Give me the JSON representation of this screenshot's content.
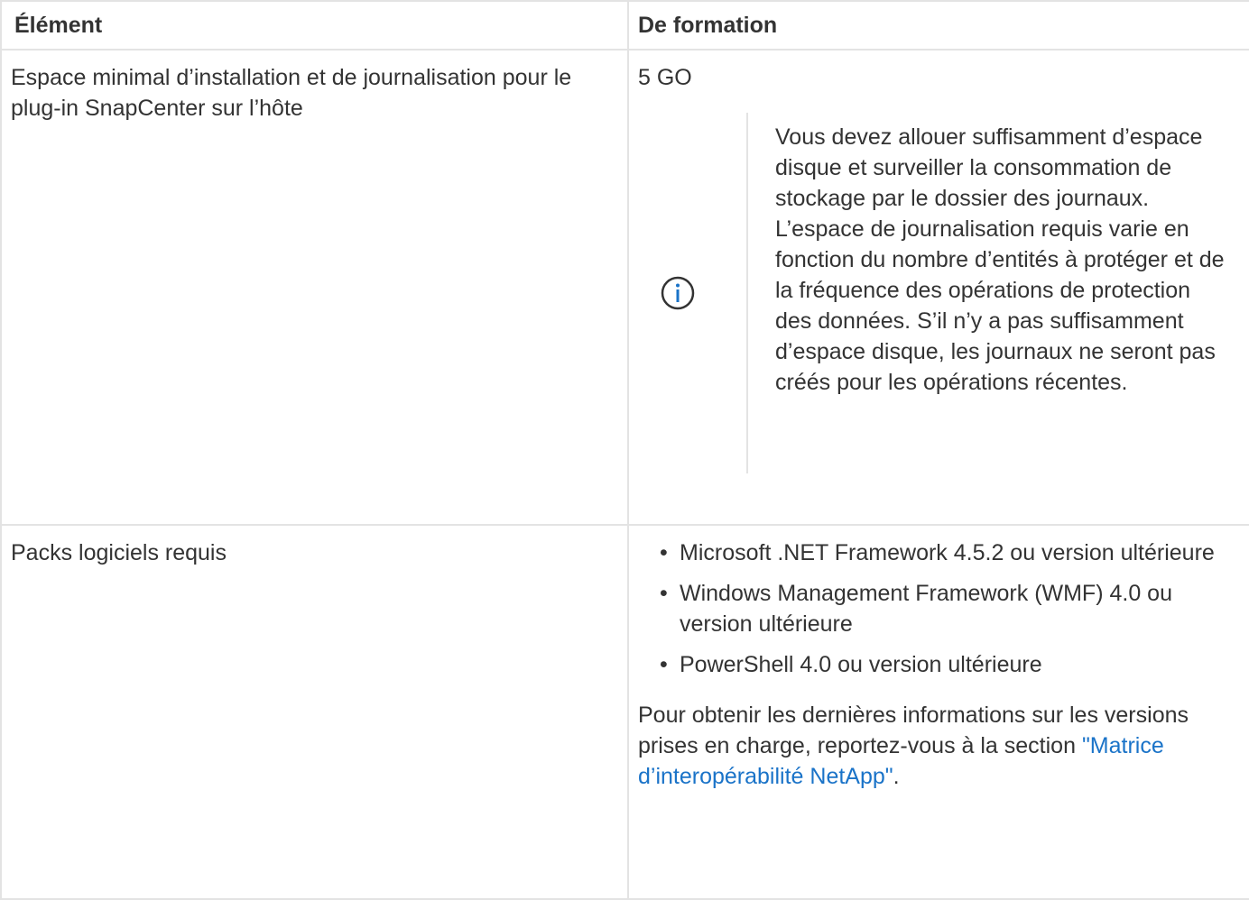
{
  "table": {
    "headers": [
      "Élément",
      "De formation"
    ],
    "row1": {
      "item": "Espace minimal d’installation et de journalisation pour le plug-in SnapCenter sur l’hôte",
      "value": "5 GO",
      "note_icon": "info-circle-icon",
      "note": "Vous devez allouer suffisamment d’espace disque et surveiller la consommation de stockage par le dossier des journaux. L’espace de journalisation requis varie en fonction du nombre d’entités à protéger et de la fréquence des opérations de protection des données. S’il n’y a pas suffisamment d’espace disque, les journaux ne seront pas créés pour les opérations récentes."
    },
    "row2": {
      "item": "Packs logiciels requis",
      "packages": [
        "Microsoft .NET Framework 4.5.2 ou version ultérieure",
        "Windows Management Framework (WMF) 4.0 ou version ultérieure",
        "PowerShell 4.0 ou version ultérieure"
      ],
      "info_text": "Pour obtenir les dernières informations sur les versions prises en charge, reportez-vous à la section",
      "link_text": "\"Matrice d’interopérabilité NetApp\"",
      "trailing": "."
    }
  },
  "colors": {
    "link": "#1a73c8",
    "icon": "#1a73c8",
    "border": "#e3e3e3",
    "text": "#333333"
  }
}
